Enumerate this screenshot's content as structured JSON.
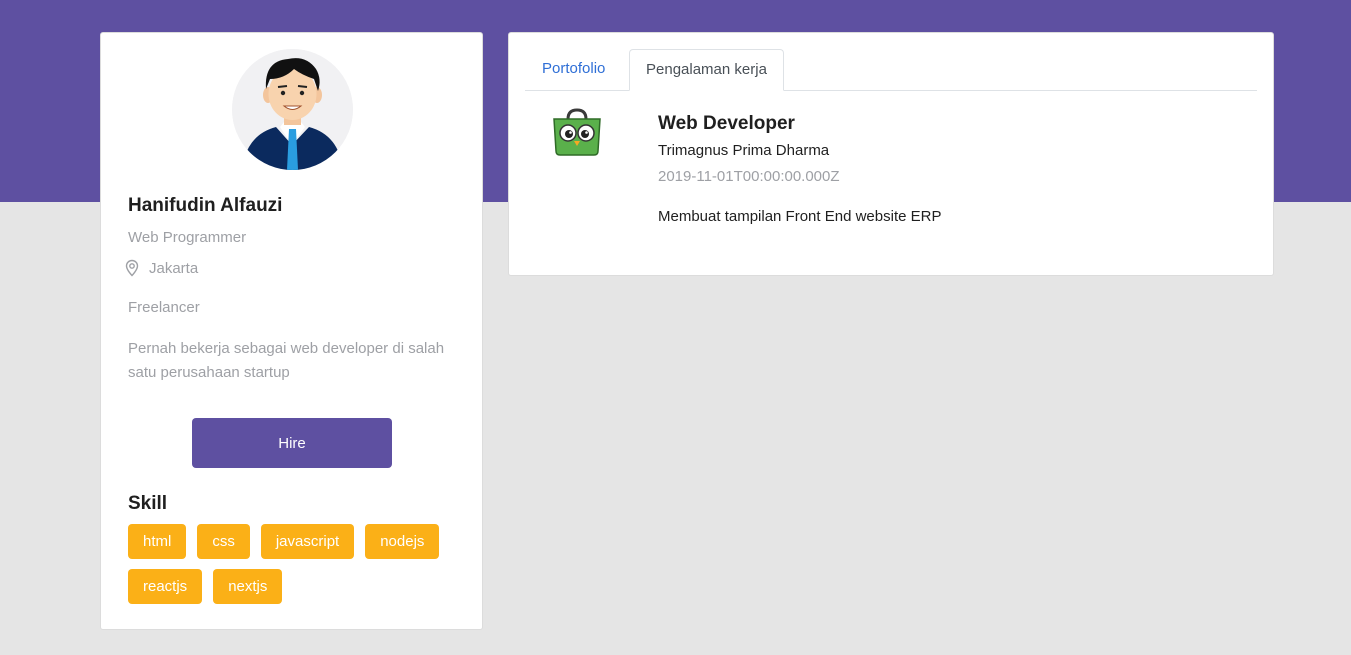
{
  "profile": {
    "name": "Hanifudin Alfauzi",
    "job": "Web Programmer",
    "location": "Jakarta",
    "work_type": "Freelancer",
    "bio": "Pernah bekerja sebagai web developer di salah satu perusahaan startup",
    "hire_label": "Hire",
    "avatar_icon": "user-avatar-icon",
    "location_icon": "map-pin-icon"
  },
  "skills": {
    "title": "Skill",
    "items": [
      "html",
      "css",
      "javascript",
      "nodejs",
      "reactjs",
      "nextjs"
    ]
  },
  "tabs": {
    "portfolio": "Portofolio",
    "experience": "Pengalaman kerja",
    "active": "experience"
  },
  "experience": {
    "position": "Web Developer",
    "company": "Trimagnus Prima Dharma",
    "date": "2019-11-01T00:00:00.000Z",
    "description": "Membuat tampilan Front End website ERP",
    "logo_icon": "owl-bag-logo-icon"
  },
  "colors": {
    "brand": "#5e50a1",
    "skill_chip": "#fbb017",
    "background": "#e5e5e5",
    "link": "#2f6fd6",
    "muted_text": "#9ea0a5"
  }
}
